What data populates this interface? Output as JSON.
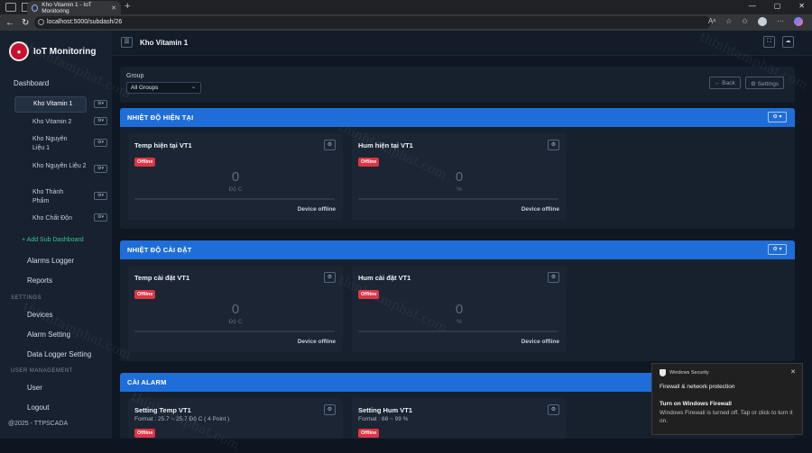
{
  "browser": {
    "tab_title": "Kho Vitamin 1 - IoT Monitoring",
    "url": "localhost:5000/subdash/26",
    "back": "←",
    "reload": "↻",
    "new_tab": "+",
    "win_min": "—",
    "win_max": "▢",
    "win_close": "✕",
    "tab_close": "✕"
  },
  "sidebar": {
    "brand": "IoT Monitoring",
    "dashboard": "Dashboard",
    "subdashboards": [
      {
        "label": "Kho Vitamin 1",
        "active": true
      },
      {
        "label": "Kho Vitamin 2"
      },
      {
        "label": "Kho Nguyên Liệu 1"
      },
      {
        "label": "Kho Nguyên Liệu 2"
      },
      {
        "label": "Kho Thành Phẩm"
      },
      {
        "label": "Kho Chất Độn"
      }
    ],
    "add_sub": "+ Add Sub Dashboard",
    "alarms_logger": "Alarms Logger",
    "reports": "Reports",
    "settings_section": "SETTINGS",
    "devices": "Devices",
    "alarm_setting": "Alarm Setting",
    "data_logger_setting": "Data Logger Setting",
    "user_mgmt_section": "USER MANAGEMENT",
    "user": "User",
    "logout": "Logout",
    "footer": "@2025 - TTPSCADA"
  },
  "topbar": {
    "title": "Kho Vitamin 1"
  },
  "filter": {
    "group_label": "Group",
    "group_value": "All Groups",
    "back_label": "← Back",
    "settings_label": "⚙ Settings"
  },
  "groups": [
    {
      "title": "NHIỆT ĐỘ HIỆN TẠI",
      "cards": [
        {
          "title": "Temp hiện tại VT1",
          "badge": "Offline",
          "value": "0",
          "unit": "Độ C",
          "progress": 0,
          "status": "Device offline"
        },
        {
          "title": "Hum hiện tại VT1",
          "badge": "Offline",
          "value": "0",
          "unit": "%",
          "progress": 0,
          "status": "Device offline"
        }
      ]
    },
    {
      "title": "NHIỆT ĐỘ CÀI ĐẶT",
      "cards": [
        {
          "title": "Temp cài đặt VT1",
          "badge": "Offline",
          "value": "0",
          "unit": "Độ C",
          "progress": 0,
          "status": "Device offline"
        },
        {
          "title": "Hum cài đặt VT1",
          "badge": "Offline",
          "value": "0",
          "unit": "%",
          "progress": 0,
          "status": "Device offline"
        }
      ]
    },
    {
      "title": "CÀI ALARM",
      "cards": [
        {
          "title": "Setting Temp VT1",
          "format": "Format : 25.7 ~ 25.7 Độ C ( 4 Point )",
          "badge": "Offline"
        },
        {
          "title": "Setting Hum VT1",
          "format": "Format : 68 ~ 99 %",
          "badge": "Offline"
        }
      ]
    }
  ],
  "toast": {
    "app": "Windows Security",
    "heading": "Firewall & network protection",
    "title": "Turn on Windows Firewall",
    "body": "Windows Firewall is turned off. Tap or click to turn it on."
  },
  "watermark": "thinhtamphat.com",
  "colors": {
    "accent": "#1f6dd8",
    "offline": "#dc3545",
    "add": "#37c28a"
  }
}
